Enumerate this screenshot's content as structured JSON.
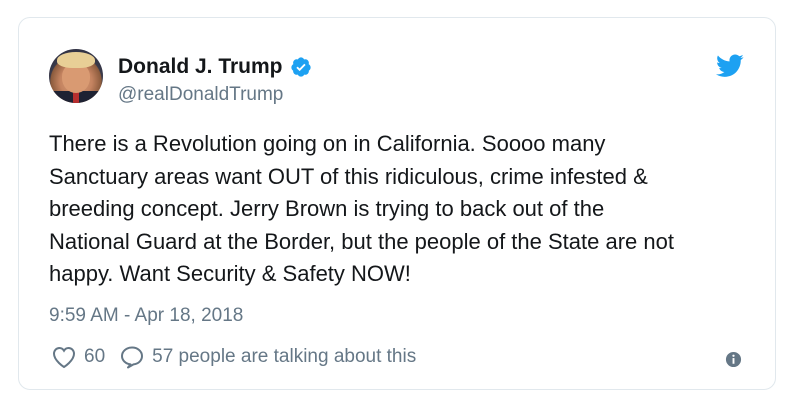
{
  "tweet": {
    "author_name": "Donald J. Trump",
    "handle": "@realDonaldTrump",
    "text": "There is a Revolution going on in California. Soooo many\nSanctuary areas want OUT of this ridiculous, crime infested &\nbreeding concept. Jerry Brown is trying to back out of the\nNational Guard at the Border, but the people of the State are not\nhappy. Want Security & Safety NOW!",
    "timestamp": "9:59 AM - Apr 18, 2018",
    "likes": "60",
    "talking": "57 people are talking about this"
  },
  "icons": {
    "verified": "verified-badge-icon",
    "brand": "twitter-bird-icon",
    "like": "heart-icon",
    "reply": "speech-bubble-icon",
    "info": "info-icon"
  },
  "colors": {
    "brand_blue": "#1da1f2",
    "text": "#14171a",
    "secondary": "#657786",
    "border": "#e1e8ed"
  }
}
